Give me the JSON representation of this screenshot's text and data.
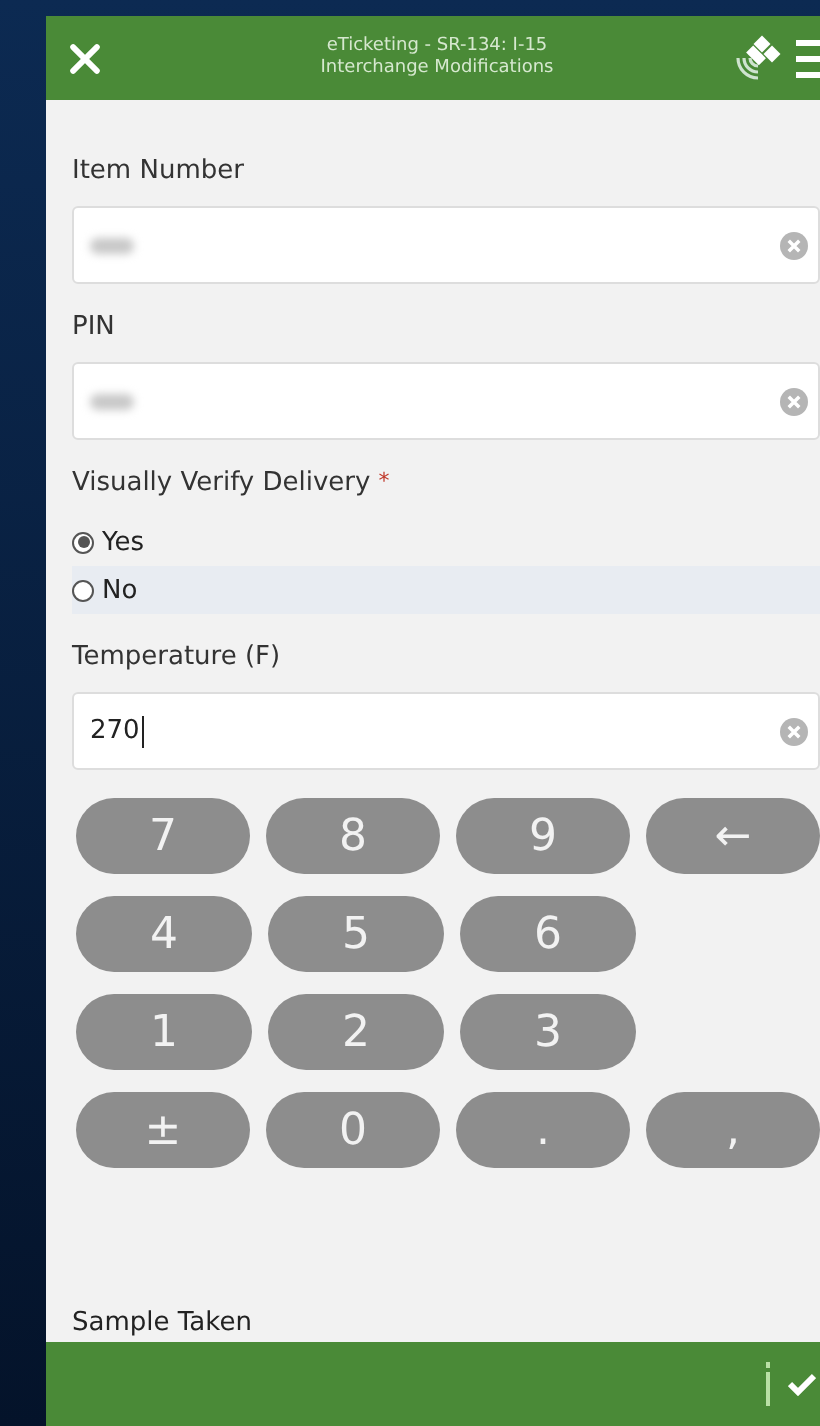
{
  "header": {
    "title_lines": [
      "eTicketing - SR-134: I-15",
      "Interchange Modifications"
    ]
  },
  "fields": [
    {
      "kind": "text",
      "label": "Item Number",
      "blurred": true
    },
    {
      "kind": "text",
      "label": "PIN",
      "blurred": true
    },
    {
      "kind": "radio",
      "label": "Visually Verify Delivery",
      "required_mark": "*",
      "options": [
        {
          "label": "Yes",
          "selected": true
        },
        {
          "label": "No",
          "selected": false
        }
      ]
    },
    {
      "kind": "text",
      "label": "Temperature (F)",
      "value": "270"
    }
  ],
  "keypad": [
    [
      "7",
      "8",
      "9",
      "←"
    ],
    [
      "4",
      "5",
      "6"
    ],
    [
      "1",
      "2",
      "3"
    ],
    [
      "±",
      "0",
      ".",
      ","
    ]
  ],
  "next_label": "Sample Taken"
}
